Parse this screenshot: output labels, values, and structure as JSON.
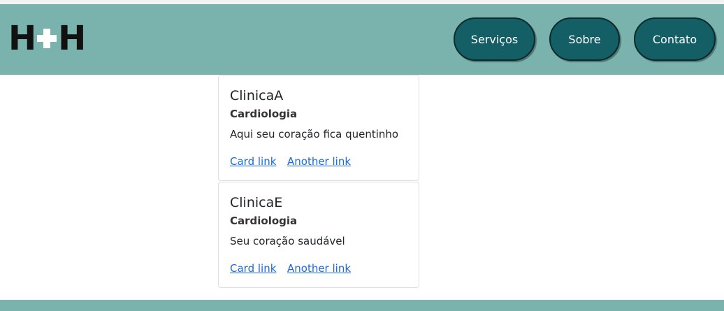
{
  "header": {
    "logo_left": "H",
    "logo_right": "H",
    "background": "#7ab3ad",
    "nav": [
      {
        "label": "Serviços"
      },
      {
        "label": "Sobre"
      },
      {
        "label": "Contato"
      }
    ],
    "nav_button_color": "#145f66"
  },
  "cards": [
    {
      "title": "ClinicaA",
      "subtitle": "Cardiologia",
      "text": "Aqui seu coração fica quentinho",
      "link1": "Card link",
      "link2": "Another link"
    },
    {
      "title": "ClinicaE",
      "subtitle": "Cardiologia",
      "text": "Seu coração saudável",
      "link1": "Card link",
      "link2": "Another link"
    }
  ],
  "link_color": "#1a6be0"
}
